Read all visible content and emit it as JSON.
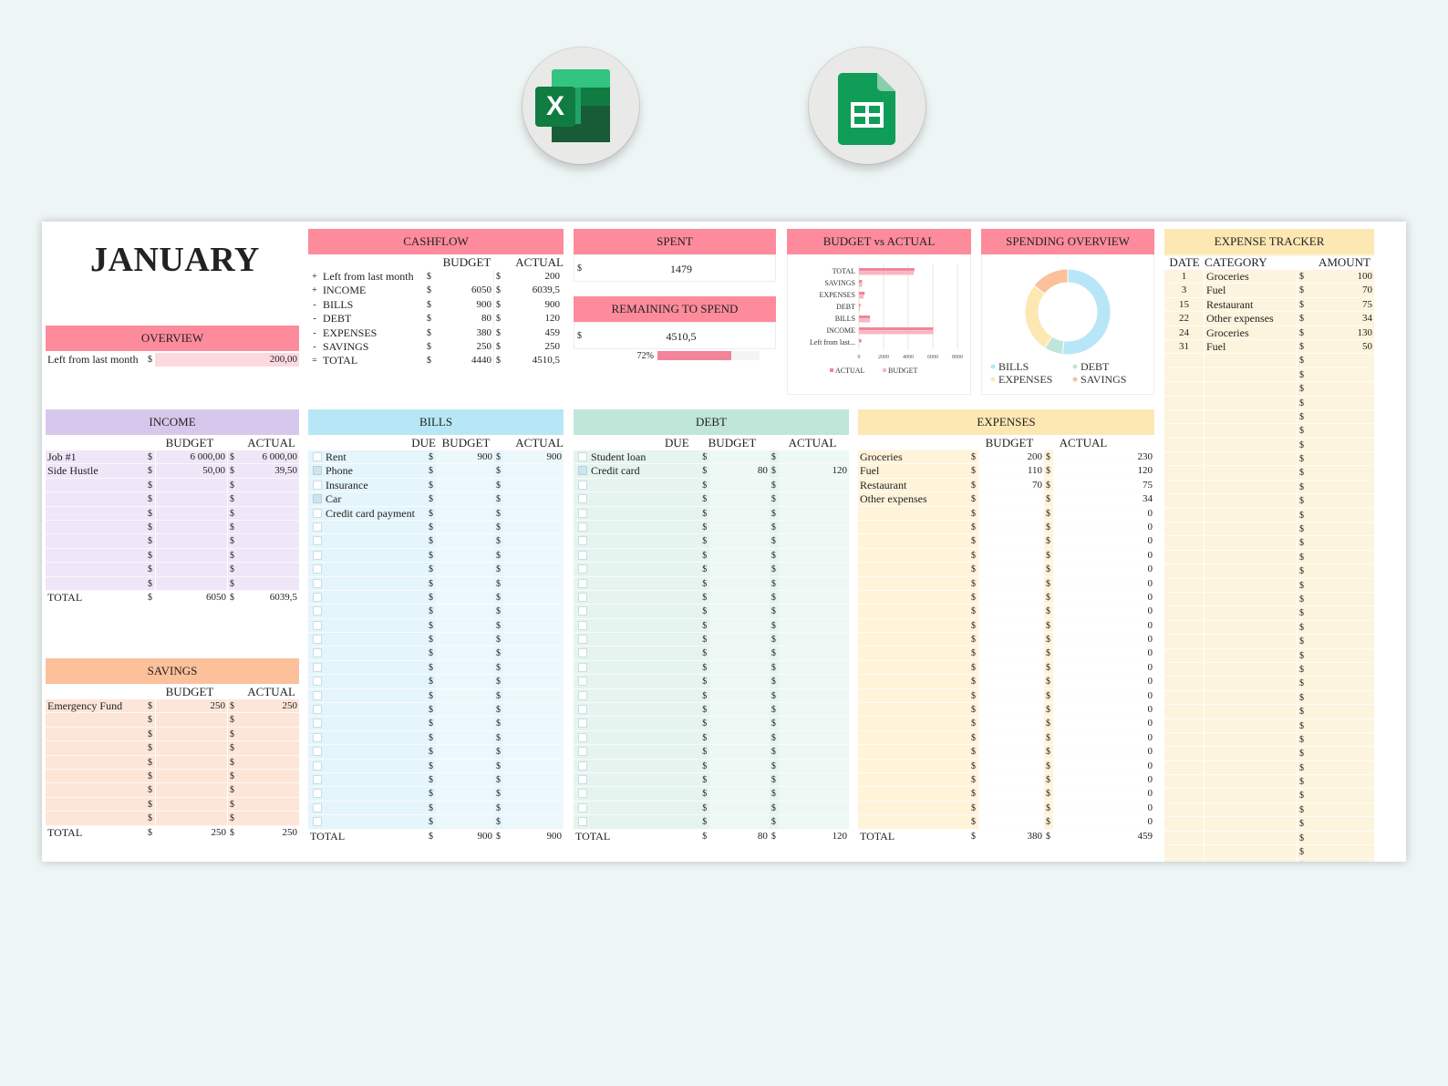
{
  "apps": {
    "excel": "Excel",
    "sheets": "Google Sheets"
  },
  "colors": {
    "pink": "#fd8b9b",
    "lavender": "#d8c7ec",
    "blue": "#b7e7f6",
    "mint": "#bfe6d9",
    "yellow": "#fde8b4",
    "peach": "#fcc09b",
    "pink_light": "#fcd9df"
  },
  "month": "JANUARY",
  "overview": {
    "title": "OVERVIEW",
    "label": "Left from last month",
    "cur": "$",
    "value": "200,00"
  },
  "cashflow": {
    "title": "CASHFLOW",
    "col_budget": "BUDGET",
    "col_actual": "ACTUAL",
    "rows": [
      {
        "sign": "+",
        "label": "Left from last month",
        "cur": "$",
        "budget": "",
        "cur2": "$",
        "actual": "200"
      },
      {
        "sign": "+",
        "label": "INCOME",
        "cur": "$",
        "budget": "6050",
        "cur2": "$",
        "actual": "6039,5"
      },
      {
        "sign": "-",
        "label": "BILLS",
        "cur": "$",
        "budget": "900",
        "cur2": "$",
        "actual": "900"
      },
      {
        "sign": "-",
        "label": "DEBT",
        "cur": "$",
        "budget": "80",
        "cur2": "$",
        "actual": "120"
      },
      {
        "sign": "-",
        "label": "EXPENSES",
        "cur": "$",
        "budget": "380",
        "cur2": "$",
        "actual": "459"
      },
      {
        "sign": "-",
        "label": "SAVINGS",
        "cur": "$",
        "budget": "250",
        "cur2": "$",
        "actual": "250"
      },
      {
        "sign": "=",
        "label": "TOTAL",
        "cur": "$",
        "budget": "4440",
        "cur2": "$",
        "actual": "4510,5"
      }
    ]
  },
  "spent": {
    "title": "SPENT",
    "cur": "$",
    "value": "1479"
  },
  "remaining": {
    "title": "REMAINING TO SPEND",
    "cur": "$",
    "value": "4510,5",
    "percent_label": "72%",
    "percent": 0.72
  },
  "budget_vs_actual": {
    "title": "BUDGET vs ACTUAL",
    "chart_data": {
      "type": "bar",
      "orientation": "horizontal",
      "categories": [
        "TOTAL",
        "SAVINGS",
        "EXPENSES",
        "DEBT",
        "BILLS",
        "INCOME",
        "Left from last..."
      ],
      "series": [
        {
          "name": "ACTUAL",
          "values": [
            4510.5,
            250,
            459,
            120,
            900,
            6039.5,
            200
          ]
        },
        {
          "name": "BUDGET",
          "values": [
            4440,
            250,
            380,
            80,
            900,
            6050,
            0
          ]
        }
      ],
      "xticks": [
        "0",
        "2000",
        "4000",
        "6000",
        "8000"
      ],
      "xlim": [
        0,
        8000
      ],
      "legend": "bottom",
      "colors": [
        "#f2849a",
        "#f7b7c3"
      ]
    }
  },
  "spending_overview": {
    "title": "SPENDING OVERVIEW",
    "chart_data": {
      "type": "pie",
      "style": "donut",
      "labels": [
        "BILLS",
        "DEBT",
        "EXPENSES",
        "SAVINGS"
      ],
      "values": [
        900,
        120,
        459,
        250
      ],
      "colors": [
        "#b7e7f6",
        "#bfe6d9",
        "#fde8b4",
        "#fcc09b"
      ],
      "legend": "bottom"
    }
  },
  "income": {
    "title": "INCOME",
    "col_budget": "BUDGET",
    "col_actual": "ACTUAL",
    "rows": [
      {
        "label": "Job #1",
        "budget": "6 000,00",
        "actual": "6 000,00"
      },
      {
        "label": "Side Hustle",
        "budget": "50,00",
        "actual": "39,50"
      },
      {
        "label": "",
        "budget": "",
        "actual": ""
      },
      {
        "label": "",
        "budget": "",
        "actual": ""
      },
      {
        "label": "",
        "budget": "",
        "actual": ""
      },
      {
        "label": "",
        "budget": "",
        "actual": ""
      },
      {
        "label": "",
        "budget": "",
        "actual": ""
      },
      {
        "label": "",
        "budget": "",
        "actual": ""
      },
      {
        "label": "",
        "budget": "",
        "actual": ""
      },
      {
        "label": "",
        "budget": "",
        "actual": ""
      }
    ],
    "total_label": "TOTAL",
    "total_budget": "6050",
    "total_actual": "6039,5",
    "cur": "$"
  },
  "savings": {
    "title": "SAVINGS",
    "col_budget": "BUDGET",
    "col_actual": "ACTUAL",
    "rows": [
      {
        "label": "Emergency Fund",
        "budget": "250",
        "actual": "250"
      },
      {
        "label": "",
        "budget": "",
        "actual": ""
      },
      {
        "label": "",
        "budget": "",
        "actual": ""
      },
      {
        "label": "",
        "budget": "",
        "actual": ""
      },
      {
        "label": "",
        "budget": "",
        "actual": ""
      },
      {
        "label": "",
        "budget": "",
        "actual": ""
      },
      {
        "label": "",
        "budget": "",
        "actual": ""
      },
      {
        "label": "",
        "budget": "",
        "actual": ""
      },
      {
        "label": "",
        "budget": "",
        "actual": ""
      }
    ],
    "total_label": "TOTAL",
    "total_budget": "250",
    "total_actual": "250",
    "cur": "$"
  },
  "bills": {
    "title": "BILLS",
    "col_due": "DUE",
    "col_budget": "BUDGET",
    "col_actual": "ACTUAL",
    "rows": [
      {
        "checked": false,
        "label": "Rent",
        "budget": "900",
        "actual": "900"
      },
      {
        "checked": true,
        "label": "Phone",
        "budget": "",
        "actual": ""
      },
      {
        "checked": false,
        "label": "Insurance",
        "budget": "",
        "actual": ""
      },
      {
        "checked": true,
        "label": "Car",
        "budget": "",
        "actual": ""
      },
      {
        "checked": false,
        "label": "Credit card payment",
        "budget": "",
        "actual": ""
      }
    ],
    "blank_rows": 22,
    "total_label": "TOTAL",
    "total_budget": "900",
    "total_actual": "900",
    "cur": "$"
  },
  "debt": {
    "title": "DEBT",
    "col_due": "DUE",
    "col_budget": "BUDGET",
    "col_actual": "ACTUAL",
    "rows": [
      {
        "checked": false,
        "label": "Student loan",
        "budget": "",
        "actual": ""
      },
      {
        "checked": true,
        "label": "Credit card",
        "budget": "80",
        "actual": "120"
      }
    ],
    "blank_rows": 25,
    "total_label": "TOTAL",
    "total_budget": "80",
    "total_actual": "120",
    "cur": "$"
  },
  "expenses": {
    "title": "EXPENSES",
    "col_budget": "BUDGET",
    "col_actual": "ACTUAL",
    "rows": [
      {
        "label": "Groceries",
        "budget": "200",
        "actual": "230"
      },
      {
        "label": "Fuel",
        "budget": "110",
        "actual": "120"
      },
      {
        "label": "Restaurant",
        "budget": "70",
        "actual": "75"
      },
      {
        "label": "Other expenses",
        "budget": "",
        "actual": "34"
      }
    ],
    "blank_rows": 23,
    "blank_actual": "0",
    "total_label": "TOTAL",
    "total_budget": "380",
    "total_actual": "459",
    "cur": "$"
  },
  "tracker": {
    "title": "EXPENSE TRACKER",
    "col_date": "DATE",
    "col_category": "CATEGORY",
    "col_amount": "AMOUNT",
    "rows": [
      {
        "date": "1",
        "category": "Groceries",
        "amount": "100"
      },
      {
        "date": "3",
        "category": "Fuel",
        "amount": "70"
      },
      {
        "date": "15",
        "category": "Restaurant",
        "amount": "75"
      },
      {
        "date": "22",
        "category": "Other expenses",
        "amount": "34"
      },
      {
        "date": "24",
        "category": "Groceries",
        "amount": "130"
      },
      {
        "date": "31",
        "category": "Fuel",
        "amount": "50"
      }
    ],
    "blank_rows": 37,
    "cur": "$"
  }
}
